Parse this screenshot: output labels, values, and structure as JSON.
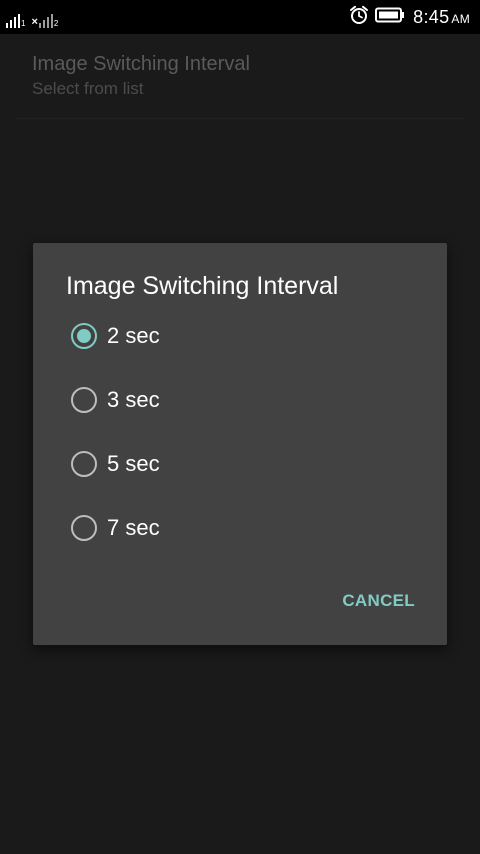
{
  "status_bar": {
    "time": "8:45",
    "am_pm": "AM",
    "sim1_index": "1",
    "sim2_index": "2",
    "sim2_no_service": "×",
    "icons": [
      "signal-icon",
      "signal-no-service-icon",
      "alarm-clock-icon",
      "battery-icon"
    ]
  },
  "preference": {
    "title": "Image Switching Interval",
    "summary": "Select from list"
  },
  "dialog": {
    "title": "Image Switching Interval",
    "options": [
      {
        "label": "2 sec",
        "selected": true
      },
      {
        "label": "3 sec",
        "selected": false
      },
      {
        "label": "5 sec",
        "selected": false
      },
      {
        "label": "7 sec",
        "selected": false
      }
    ],
    "cancel_label": "CANCEL"
  },
  "colors": {
    "accent": "#80cbc4",
    "dialog_background": "#424242",
    "screen_background": "#1a1a1a",
    "status_bar_background": "#000000"
  }
}
